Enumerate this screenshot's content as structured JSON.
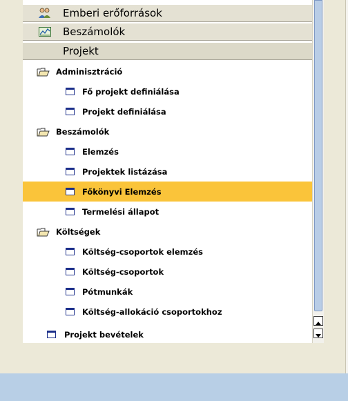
{
  "modules": [
    {
      "label": "Emberi erőforrások",
      "icon": "people-icon"
    },
    {
      "label": "Beszámolók",
      "icon": "report-chart-icon"
    },
    {
      "label": "Projekt",
      "icon": ""
    }
  ],
  "tree": {
    "administration": {
      "label": "Adminisztráció",
      "items": [
        "Fő projekt definiálása",
        "Projekt definiálása"
      ]
    },
    "reports": {
      "label": "Beszámolók",
      "items": [
        "Elemzés",
        "Projektek listázása",
        "Főkönyvi Elemzés",
        "Termelési állapot"
      ],
      "selected": "Főkönyvi Elemzés"
    },
    "costs": {
      "label": "Költségek",
      "items": [
        "Költség-csoportok elemzés",
        "Költség-csoportok",
        "Pótmunkák",
        "Költség-allokáció csoportokhoz"
      ]
    },
    "root_items": [
      "Projekt bevételek"
    ]
  },
  "colors": {
    "selection": "#fac43a",
    "scroll_thumb": "#b9cde6",
    "background": "#b8cfe6",
    "panel": "#ece9d8"
  }
}
